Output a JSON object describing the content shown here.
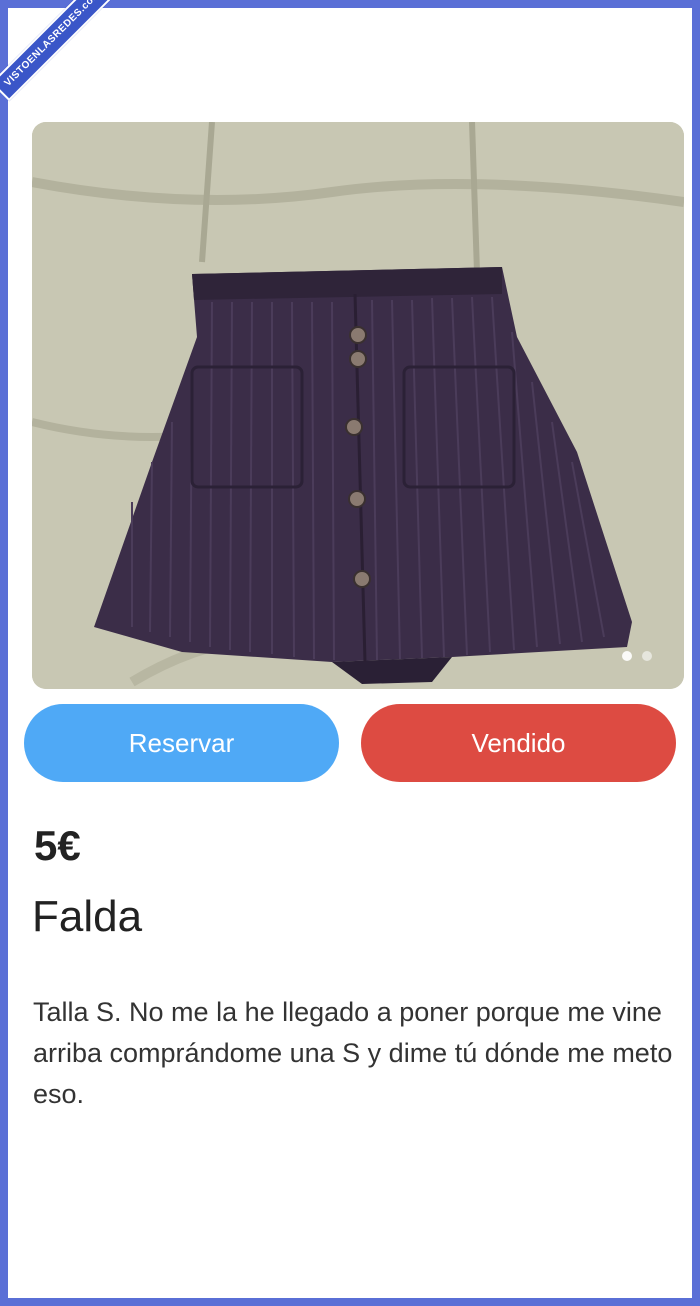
{
  "watermark": "VISTOENLASREDES.com",
  "listing": {
    "price": "5€",
    "title": "Falda",
    "description": "Talla S. No me la he llegado a poner porque me vine arriba comprándome una S y dime tú dónde me meto eso.",
    "image_dots": 2
  },
  "actions": {
    "reserve_label": "Reservar",
    "sold_label": "Vendido"
  },
  "colors": {
    "reserve": "#4fa9f6",
    "sold": "#dd4b42",
    "frame": "#5a6fd6"
  }
}
